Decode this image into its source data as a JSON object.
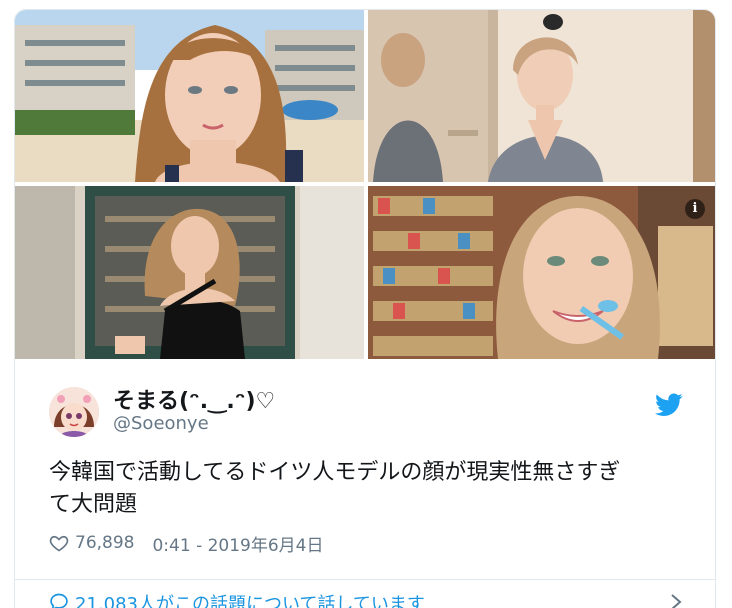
{
  "tweet": {
    "display_name": "そまる(ᵔ.‿.ᵔ)♡",
    "handle": "@Soeonye",
    "text_line1": "今韓国で活動してるドイツ人モデルの顔が現実性無さすぎ",
    "text_line2": "て大問題",
    "likes": "76,898",
    "timestamp": "0:41 - 2019年6月4日",
    "replies_text": "21,083人がこの話題について話しています"
  },
  "icons": {
    "info": "info-icon",
    "bird": "twitter-bird-icon",
    "heart": "heart-icon",
    "reply": "speech-bubble-icon",
    "chevron": "chevron-right-icon"
  },
  "info_glyph": "i",
  "colors": {
    "brand": "#1da1f2",
    "link": "#1b95e0",
    "secondary_text": "#657786",
    "border": "#e1e8ed"
  }
}
